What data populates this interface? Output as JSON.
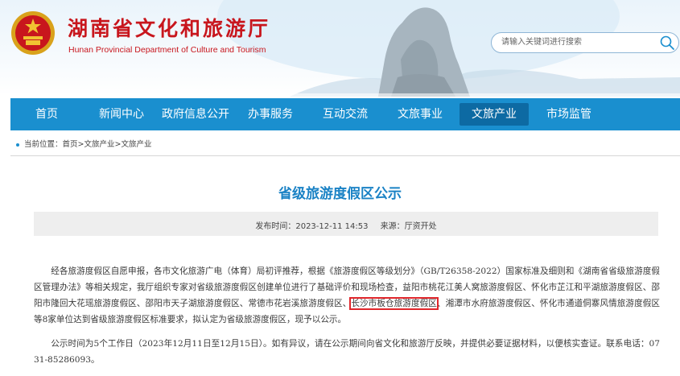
{
  "site": {
    "title": "湖南省文化和旅游厅",
    "subtitle": "Hunan Provincial Department of Culture and Tourism",
    "emblem_icon": "national-emblem"
  },
  "search": {
    "placeholder": "请输入关键词进行搜索",
    "icon": "search-icon"
  },
  "nav": {
    "items": [
      {
        "label": "首页"
      },
      {
        "label": "新闻中心"
      },
      {
        "label": "政府信息公开"
      },
      {
        "label": "办事服务"
      },
      {
        "label": "互动交流"
      },
      {
        "label": "文旅事业"
      },
      {
        "label": "文旅产业",
        "active": true
      },
      {
        "label": "市场监管"
      }
    ]
  },
  "breadcrumb": {
    "prefix": "当前位置：",
    "home": "首页",
    "sep1": ">",
    "level1": "文旅产业",
    "sep2": ">",
    "level2": "文旅产业"
  },
  "article": {
    "title": "省级旅游度假区公示",
    "publish_label": "发布时间：",
    "publish_time": "2023-12-11 14:53",
    "source_label": "来源：",
    "source": "厅资开处",
    "para1_a": "经各旅游度假区自愿申报，各市文化旅游广电（体育）局初评推荐，根据《旅游度假区等级划分》（GB/T26358-2022）国家标准及细则和《湖南省省级旅游度假区管理办法》等相关规定，我厅组织专家对省级旅游度假区创建单位进行了基础评价和现场检查，益阳市桃花江美人窝旅游度假区、怀化市芷江和平湖旅游度假区、邵阳市隆回大花瑶旅游度假区、邵阳市天子湖旅游度假区、常德市花岩溪旅游度假区、",
    "para1_highlight": "长沙市板仓旅游度假区",
    "para1_b": "、湘潭市水府旅游度假区、怀化市通道侗寨风情旅游度假区等8家单位达到省级旅游度假区标准要求，拟认定为省级旅游度假区，现予以公示。",
    "para2": "公示时间为5个工作日（2023年12月11日至12月15日）。如有异议，请在公示期间向省文化和旅游厅反映，并提供必要证据材料，以便核实查证。联系电话：0731-85286093。"
  },
  "colors": {
    "brand_red": "#c8161d",
    "nav_blue": "#1a8fcf",
    "nav_active": "#0d6aa3",
    "title_blue": "#1a82c5",
    "highlight_box": "#e0262b"
  }
}
